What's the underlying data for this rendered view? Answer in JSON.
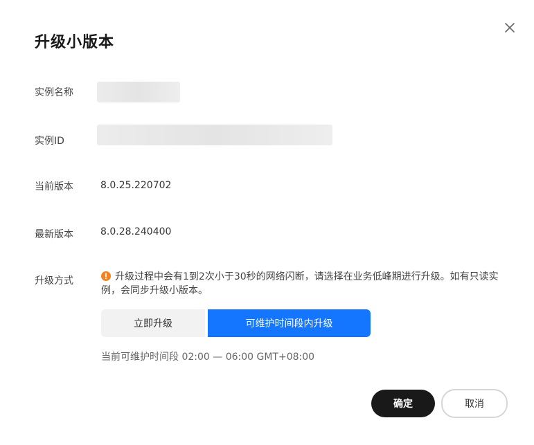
{
  "dialog": {
    "title": "升级小版本",
    "close_icon": "close-icon"
  },
  "fields": {
    "instance_name_label": "实例名称",
    "instance_id_label": "实例ID",
    "current_version_label": "当前版本",
    "current_version_value": "8.0.25.220702",
    "latest_version_label": "最新版本",
    "latest_version_value": "8.0.28.240400",
    "upgrade_method_label": "升级方式"
  },
  "notice": {
    "icon": "warning-circle-icon",
    "text": "升级过程中会有1到2次小于30秒的网络闪断，请选择在业务低峰期进行升级。如有只读实例，会同步升级小版本。",
    "color": "#f58220"
  },
  "upgrade_options": {
    "options": [
      "立即升级",
      "可维护时间段内升级"
    ],
    "selected": "可维护时间段内升级",
    "selected_color": "#1476ff"
  },
  "maintenance_window": {
    "text": "当前可维护时间段 02:00 — 06:00 GMT+08:00"
  },
  "footer": {
    "confirm_label": "确定",
    "cancel_label": "取消"
  }
}
